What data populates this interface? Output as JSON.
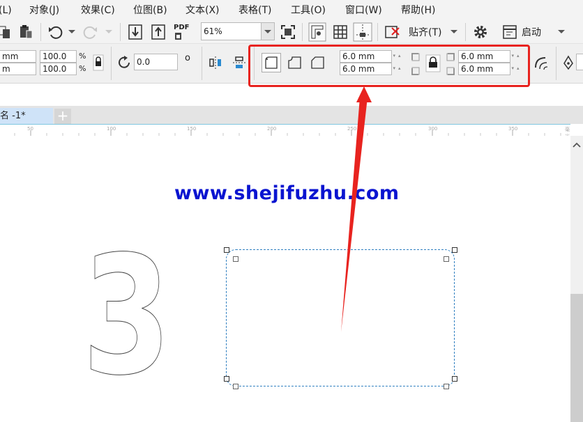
{
  "menu": [
    "(L)",
    "对象(J)",
    "效果(C)",
    "位图(B)",
    "文本(X)",
    "表格(T)",
    "工具(O)",
    "窗口(W)",
    "帮助(H)"
  ],
  "toolbar1": {
    "pdf_label": "PDF",
    "zoom_value": "61%",
    "snap_label": "贴齐(T)",
    "launch_label": "启动"
  },
  "property_bar": {
    "size_w_unit": "mm",
    "size_h_unit": "m",
    "scale_x": "100.0",
    "scale_y": "100.0",
    "percent": "%",
    "rotation": "0.0",
    "degree": "o",
    "corner_tl": "6.0 mm",
    "corner_bl": "6.0 mm",
    "corner_tr": "6.0 mm",
    "corner_br": "6.0 mm"
  },
  "document_tab": {
    "label": "名 -1*",
    "add_label": "+"
  },
  "ruler": {
    "labels": [
      "50",
      "100",
      "150",
      "200",
      "250",
      "300",
      "350"
    ],
    "unit": "毫米"
  },
  "canvas": {
    "watermark": "www.shejifuzhu.com",
    "digit": "3"
  },
  "colors": {
    "highlight": "#e8231f",
    "watermark": "#0a14d0",
    "selection": "#2f7fc0"
  }
}
